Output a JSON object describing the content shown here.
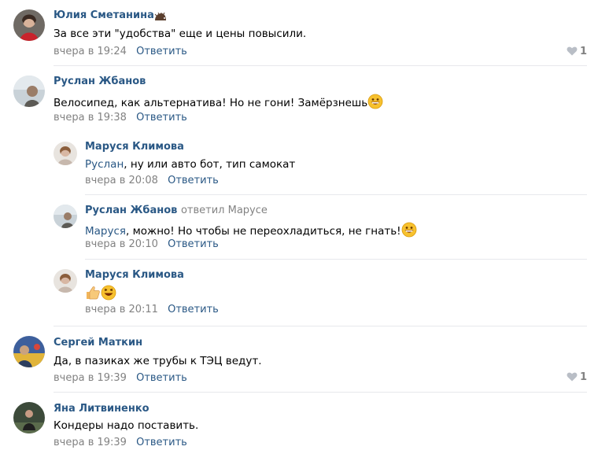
{
  "comments": [
    {
      "author": "Юлия Сметанина",
      "text": "За все эти \"удобства\" еще и цены повысили.",
      "time": "вчера в 19:24",
      "reply": "Ответить",
      "likes": "1",
      "badge_icon": "hedgehog-icon"
    },
    {
      "author": "Руслан Жбанов",
      "text": "Велосипед, как альтернатива! Но не гони! Замёрзнешь",
      "time": "вчера в 19:38",
      "reply": "Ответить",
      "emoji_icon": "grinning-emoji-icon"
    },
    {
      "author": "Маруся Климова",
      "mention": "Руслан",
      "text": ", ну или авто бот, тип самокат",
      "time": "вчера в 20:08",
      "reply": "Ответить"
    },
    {
      "author": "Руслан Жбанов",
      "replied_to": "ответил Марусе",
      "mention": "Маруся",
      "text": ", можно! Но чтобы не переохладиться, не гнать!",
      "time": "вчера в 20:10",
      "reply": "Ответить",
      "emoji_icon": "grinning-emoji-icon"
    },
    {
      "author": "Маруся Климова",
      "time": "вчера в 20:11",
      "reply": "Ответить",
      "emoji_icons": [
        "thumbs-up-emoji-icon",
        "laughing-emoji-icon"
      ]
    },
    {
      "author": "Сергей Маткин",
      "text": "Да, в пазиках же трубы к ТЭЦ ведут.",
      "time": "вчера в 19:39",
      "reply": "Ответить",
      "likes": "1"
    },
    {
      "author": "Яна Литвиненко",
      "text": "Кондеры надо поставить.",
      "time": "вчера в 19:39",
      "reply": "Ответить"
    }
  ],
  "colors": {
    "link": "#2a5885",
    "meta": "#828282",
    "divider": "#e7e8ec"
  }
}
